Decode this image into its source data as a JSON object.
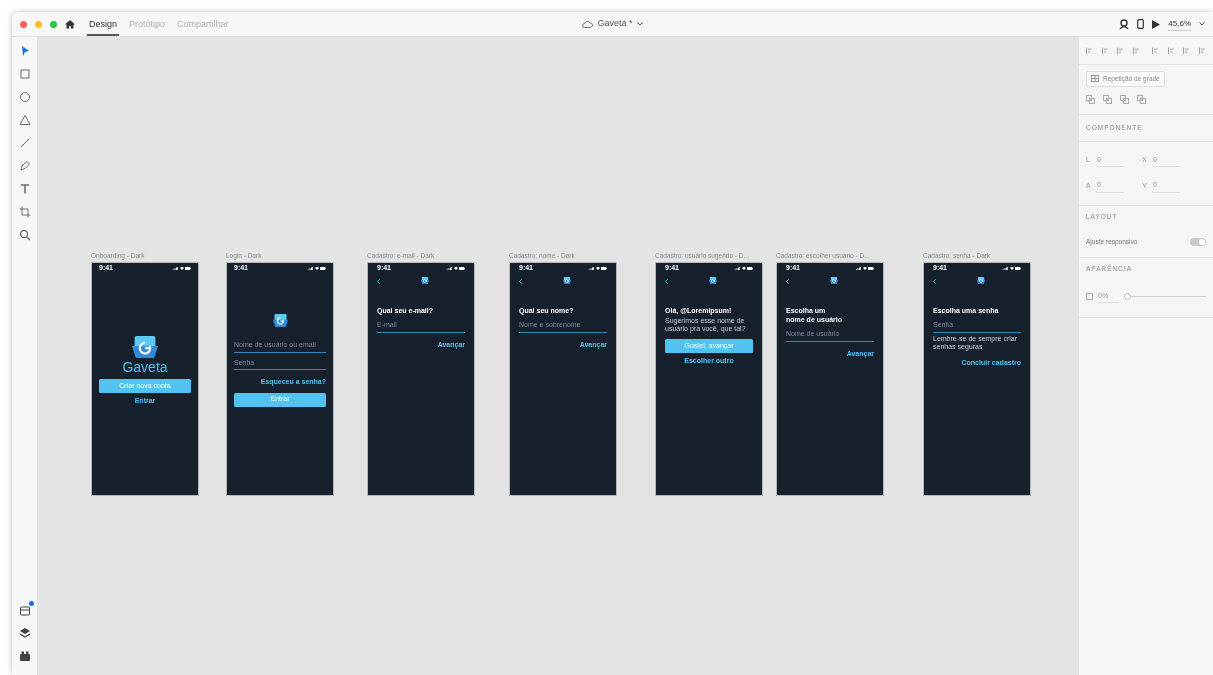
{
  "window": {
    "tabs": [
      {
        "label": "Design",
        "selected": true
      },
      {
        "label": "Protótipo",
        "selected": false
      },
      {
        "label": "Compartilhar",
        "selected": false
      }
    ],
    "document_title": "Gaveta *",
    "zoom": "45,6%"
  },
  "tools": [
    {
      "kind": "select",
      "selected": true
    },
    {
      "kind": "rectangle",
      "selected": false
    },
    {
      "kind": "ellipse",
      "selected": false
    },
    {
      "kind": "polygon",
      "selected": false
    },
    {
      "kind": "line",
      "selected": false
    },
    {
      "kind": "pen",
      "selected": false
    },
    {
      "kind": "text",
      "selected": false
    },
    {
      "kind": "artboard",
      "selected": false
    },
    {
      "kind": "zoom",
      "selected": false
    }
  ],
  "bottom_tools": [
    {
      "kind": "plugins",
      "badge": true
    },
    {
      "kind": "layers",
      "badge": false
    },
    {
      "kind": "assets",
      "badge": false
    }
  ],
  "artboards": [
    {
      "title": "Onboarding - Dark",
      "kind": "welcome",
      "time": "9:41",
      "elements": [
        {
          "kind": "logo-large",
          "wordmark": "Gaveta"
        },
        {
          "kind": "button",
          "label": "Criar nova conta"
        },
        {
          "kind": "link-center",
          "label": "Entrar"
        }
      ]
    },
    {
      "title": "Login - Dark",
      "kind": "welcome",
      "time": "9:41",
      "elements": [
        {
          "kind": "logo-small"
        },
        {
          "kind": "field",
          "placeholder": "Nome de usuário ou email"
        },
        {
          "kind": "field",
          "placeholder": "Senha"
        },
        {
          "kind": "link-right",
          "label": "Esqueceu a senha?"
        },
        {
          "kind": "button",
          "label": "Entrar"
        }
      ]
    },
    {
      "title": "Cadastro: e-mail - Dark",
      "kind": "form",
      "time": "9:41",
      "elements": [
        {
          "kind": "nav"
        },
        {
          "kind": "heading",
          "text": "Qual seu e-mail?"
        },
        {
          "kind": "field",
          "placeholder": "E-mail"
        },
        {
          "kind": "link-right",
          "label": "Avançar"
        }
      ]
    },
    {
      "title": "Cadastro: nome - Dark",
      "kind": "form",
      "time": "9:41",
      "elements": [
        {
          "kind": "nav"
        },
        {
          "kind": "heading",
          "text": "Qual seu nome?"
        },
        {
          "kind": "field",
          "placeholder": "Nome e sobrenome"
        },
        {
          "kind": "link-right",
          "label": "Avançar"
        }
      ]
    },
    {
      "title": "Cadastro: usuário sugerido - D...",
      "kind": "form",
      "time": "9:41",
      "elements": [
        {
          "kind": "nav"
        },
        {
          "kind": "heading",
          "text": "Olá, @LoremIpsum!"
        },
        {
          "kind": "subtext",
          "text": "Sugerimos esse nome de usuário pra você, que tal?"
        },
        {
          "kind": "button",
          "label": "Gostei, avançar"
        },
        {
          "kind": "link-center",
          "label": "Escolher outro"
        }
      ]
    },
    {
      "title": "Cadastro: escolher usuário - D...",
      "kind": "form",
      "time": "9:41",
      "elements": [
        {
          "kind": "nav"
        },
        {
          "kind": "heading",
          "text": "Escolha um\nnome de usuário"
        },
        {
          "kind": "field",
          "placeholder": "Nome de usuário"
        },
        {
          "kind": "link-right",
          "label": "Avançar"
        }
      ]
    },
    {
      "title": "Cadastro: senha - Dark",
      "kind": "form",
      "time": "9:41",
      "elements": [
        {
          "kind": "nav"
        },
        {
          "kind": "heading",
          "text": "Escolha uma senha"
        },
        {
          "kind": "field",
          "placeholder": "Senha"
        },
        {
          "kind": "subtext",
          "text": "Lembre-se de sempre criar senhas seguras"
        },
        {
          "kind": "link-right",
          "label": "Concluir cadastro"
        }
      ]
    }
  ],
  "properties": {
    "repeat_grid": "Repetição de grade",
    "component_header": "COMPONENTE",
    "transform": [
      {
        "label": "L",
        "value": "0"
      },
      {
        "label": "X",
        "value": "0"
      },
      {
        "label": "A",
        "value": "0"
      },
      {
        "label": "Y",
        "value": "0"
      }
    ],
    "layout_header": "LAYOUT",
    "responsive": {
      "label": "Ajuste responsivo",
      "on": true
    },
    "appearance_header": "APARÊNCIA",
    "opacity": {
      "value": "0%",
      "level": 0
    }
  }
}
